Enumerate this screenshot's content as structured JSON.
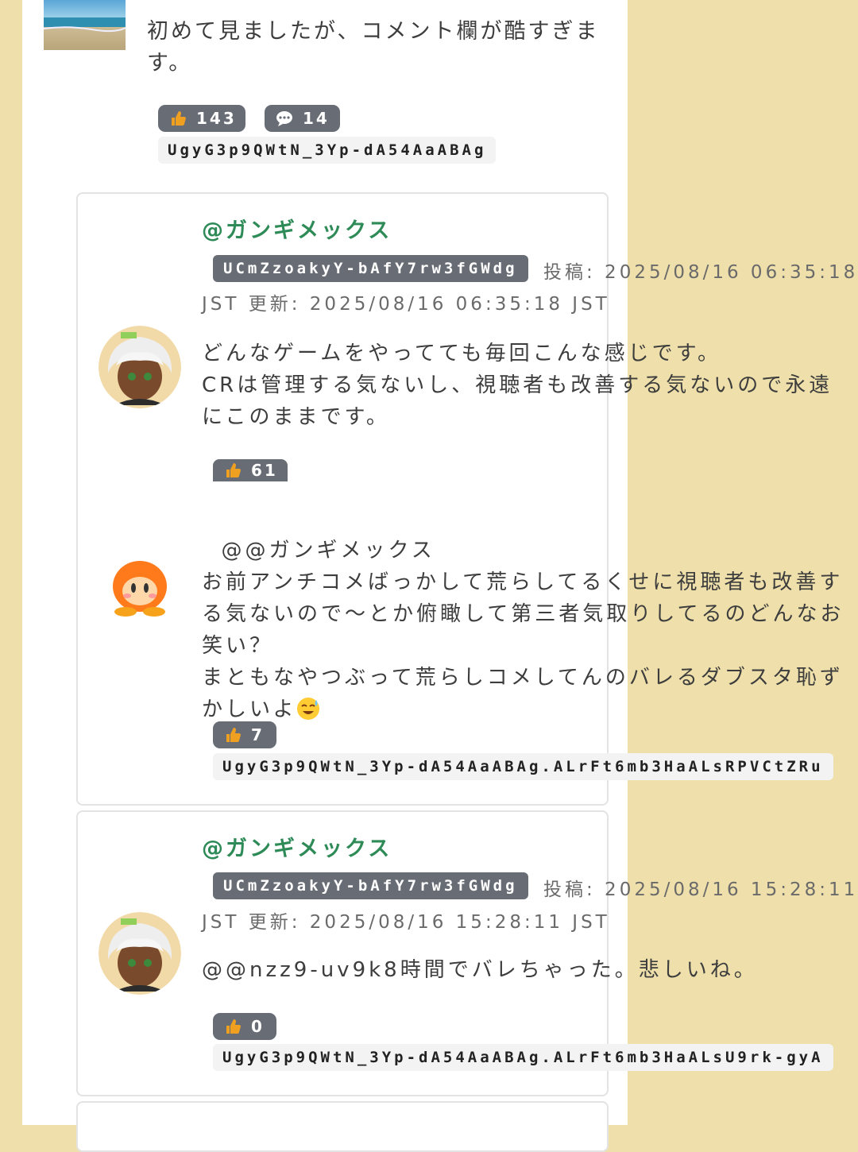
{
  "top_comment": {
    "text": "初めて見ましたが、コメント欄が酷すぎます。",
    "likes": "143",
    "replies": "14",
    "comment_id": "UgyG3p9QWtN_3Yp-dA54AaABAg"
  },
  "replies": [
    {
      "author": "@ガンギメックス",
      "channel_id": "UCmZzoakyY-bAfY7rw3fGWdg",
      "posted_line1": "投稿: 2025/08/16 06:35:18",
      "posted_line2": "JST 更新: 2025/08/16 06:35:18 JST",
      "text": "どんなゲームをやってても毎回こんな感じです。\nCRは管理する気ないし、視聴者も改善する気ないので永遠にこのままです。",
      "likes": "61",
      "nested_text": "@@ガンギメックス\nお前アンチコメばっかして荒らしてるくせに視聴者も改善する気ないので〜とか俯瞰して第三者気取りしてるのどんなお笑い？\nまともなやつぶって荒らしコメしてんのバレるダブスタ恥ずかしいよ",
      "nested_likes": "7",
      "comment_id": "UgyG3p9QWtN_3Yp-dA54AaABAg.ALrFt6mb3HaALsRPVCtZRu"
    },
    {
      "author": "@ガンギメックス",
      "channel_id": "UCmZzoakyY-bAfY7rw3fGWdg",
      "posted_line1": "投稿: 2025/08/16 15:28:11",
      "posted_line2": "JST 更新: 2025/08/16 15:28:11 JST",
      "text": "@@nzz9-uv9k8時間でバレちゃった。悲しいね。",
      "likes": "0",
      "comment_id": "UgyG3p9QWtN_3Yp-dA54AaABAg.ALrFt6mb3HaALsU9rk-gyA"
    }
  ],
  "colors": {
    "author": "#2e8b57",
    "pill": "#686d75",
    "background": "#efe0ab"
  },
  "icons": [
    "thumbs-up-icon",
    "comment-bubble-icon",
    "sweat-smile-emoji"
  ]
}
